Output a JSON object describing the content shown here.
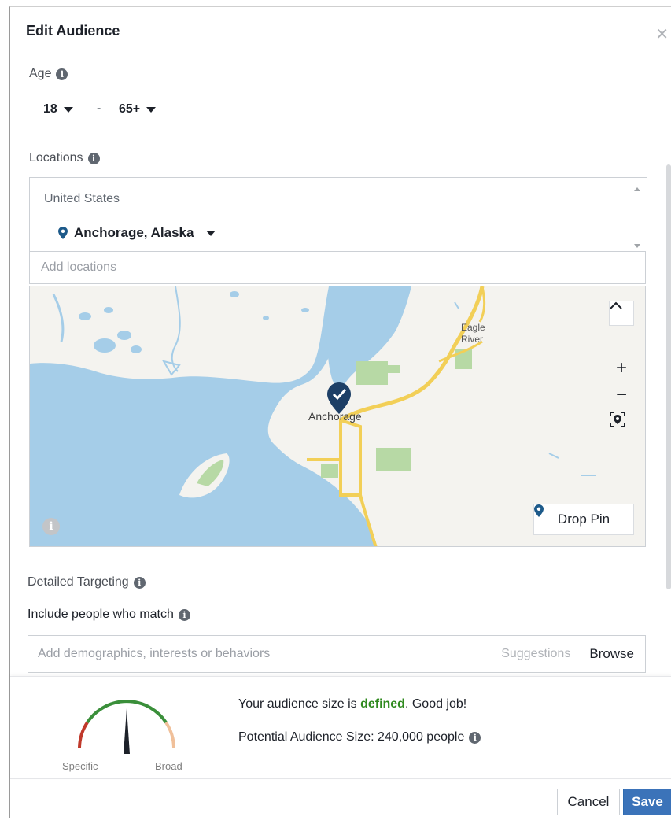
{
  "dialog": {
    "title": "Edit Audience",
    "close_icon": "close-icon"
  },
  "age": {
    "label": "Age",
    "min": "18",
    "separator": "-",
    "max": "65+"
  },
  "locations": {
    "label": "Locations",
    "country": "United States",
    "selected": "Anchorage, Alaska",
    "add_placeholder": "Add locations"
  },
  "map": {
    "city_label": "Anchorage",
    "place_label_1": "Eagle",
    "place_label_2": "River",
    "drop_pin_label": "Drop Pin",
    "zoom_in": "+",
    "zoom_out": "−",
    "info": "i",
    "colors": {
      "water": "#a5cde8",
      "land": "#f4f3ef",
      "road": "#f2cf57",
      "park": "#b7d9a5",
      "pin": "#1d3f66"
    }
  },
  "detailed_targeting": {
    "label": "Detailed Targeting",
    "include_label": "Include people who match",
    "placeholder": "Add demographics, interests or behaviors",
    "suggestions": "Suggestions",
    "browse": "Browse"
  },
  "audience": {
    "size_prefix": "Your audience size is ",
    "size_status": "defined",
    "size_suffix": ". Good job!",
    "potential": "Potential Audience Size: 240,000 people",
    "gauge_left": "Specific",
    "gauge_right": "Broad",
    "colors": {
      "defined": "#2f8a1e",
      "gauge_green": "#3a8f3a",
      "gauge_red": "#c0392b",
      "gauge_peach": "#f0c09a"
    }
  },
  "footer": {
    "cancel": "Cancel",
    "save": "Save"
  }
}
